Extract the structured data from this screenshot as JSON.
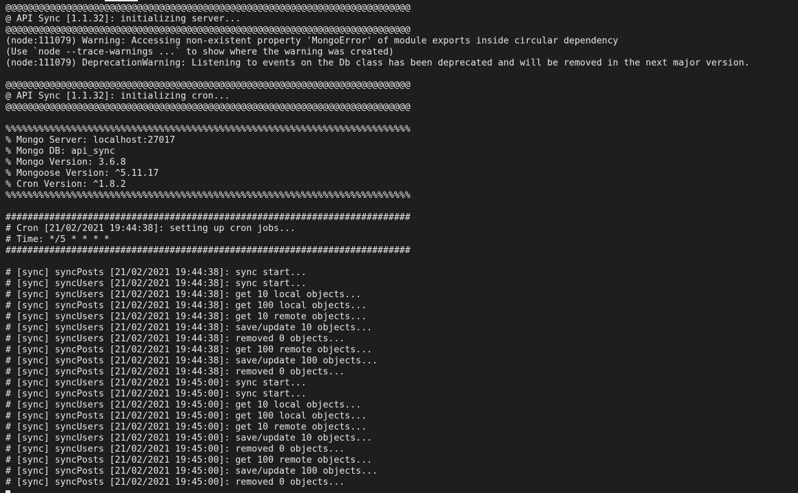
{
  "terminal": {
    "lines": [
      "@@@@@@@@@@@@@@@@@@@@@@@@@@@@@@@@@@@@@@@@@@@@@@@@@@@@@@@@@@@@@@@@@@@@@@@@@@",
      "@ API Sync [1.1.32]: initializing server...",
      "@@@@@@@@@@@@@@@@@@@@@@@@@@@@@@@@@@@@@@@@@@@@@@@@@@@@@@@@@@@@@@@@@@@@@@@@@@",
      "(node:111079) Warning: Accessing non-existent property 'MongoError' of module exports inside circular dependency",
      "(Use `node --trace-warnings ...` to show where the warning was created)",
      "(node:111079) DeprecationWarning: Listening to events on the Db class has been deprecated and will be removed in the next major version.",
      "",
      "@@@@@@@@@@@@@@@@@@@@@@@@@@@@@@@@@@@@@@@@@@@@@@@@@@@@@@@@@@@@@@@@@@@@@@@@@@",
      "@ API Sync [1.1.32]: initializing cron...",
      "@@@@@@@@@@@@@@@@@@@@@@@@@@@@@@@@@@@@@@@@@@@@@@@@@@@@@@@@@@@@@@@@@@@@@@@@@@",
      "",
      "%%%%%%%%%%%%%%%%%%%%%%%%%%%%%%%%%%%%%%%%%%%%%%%%%%%%%%%%%%%%%%%%%%%%%%%%%%",
      "% Mongo Server: localhost:27017",
      "% Mongo DB: api_sync",
      "% Mongo Version: 3.6.8",
      "% Mongoose Version: ^5.11.17",
      "% Cron Version: ^1.8.2",
      "%%%%%%%%%%%%%%%%%%%%%%%%%%%%%%%%%%%%%%%%%%%%%%%%%%%%%%%%%%%%%%%%%%%%%%%%%%",
      "",
      "##########################################################################",
      "# Cron [21/02/2021 19:44:38]: setting up cron jobs...",
      "# Time: */5 * * * *",
      "##########################################################################",
      "",
      "# [sync] syncPosts [21/02/2021 19:44:38]: sync start...",
      "# [sync] syncUsers [21/02/2021 19:44:38]: sync start...",
      "# [sync] syncUsers [21/02/2021 19:44:38]: get 10 local objects...",
      "# [sync] syncPosts [21/02/2021 19:44:38]: get 100 local objects...",
      "# [sync] syncUsers [21/02/2021 19:44:38]: get 10 remote objects...",
      "# [sync] syncUsers [21/02/2021 19:44:38]: save/update 10 objects...",
      "# [sync] syncUsers [21/02/2021 19:44:38]: removed 0 objects...",
      "# [sync] syncPosts [21/02/2021 19:44:38]: get 100 remote objects...",
      "# [sync] syncPosts [21/02/2021 19:44:38]: save/update 100 objects...",
      "# [sync] syncPosts [21/02/2021 19:44:38]: removed 0 objects...",
      "# [sync] syncUsers [21/02/2021 19:45:00]: sync start...",
      "# [sync] syncPosts [21/02/2021 19:45:00]: sync start...",
      "# [sync] syncUsers [21/02/2021 19:45:00]: get 10 local objects...",
      "# [sync] syncPosts [21/02/2021 19:45:00]: get 100 local objects...",
      "# [sync] syncUsers [21/02/2021 19:45:00]: get 10 remote objects...",
      "# [sync] syncUsers [21/02/2021 19:45:00]: save/update 10 objects...",
      "# [sync] syncUsers [21/02/2021 19:45:00]: removed 0 objects...",
      "# [sync] syncPosts [21/02/2021 19:45:00]: get 100 remote objects...",
      "# [sync] syncPosts [21/02/2021 19:45:00]: save/update 100 objects...",
      "# [sync] syncPosts [21/02/2021 19:45:00]: removed 0 objects..."
    ]
  },
  "colors": {
    "background": "#1e1e1e",
    "foreground": "#e6e6e6"
  }
}
